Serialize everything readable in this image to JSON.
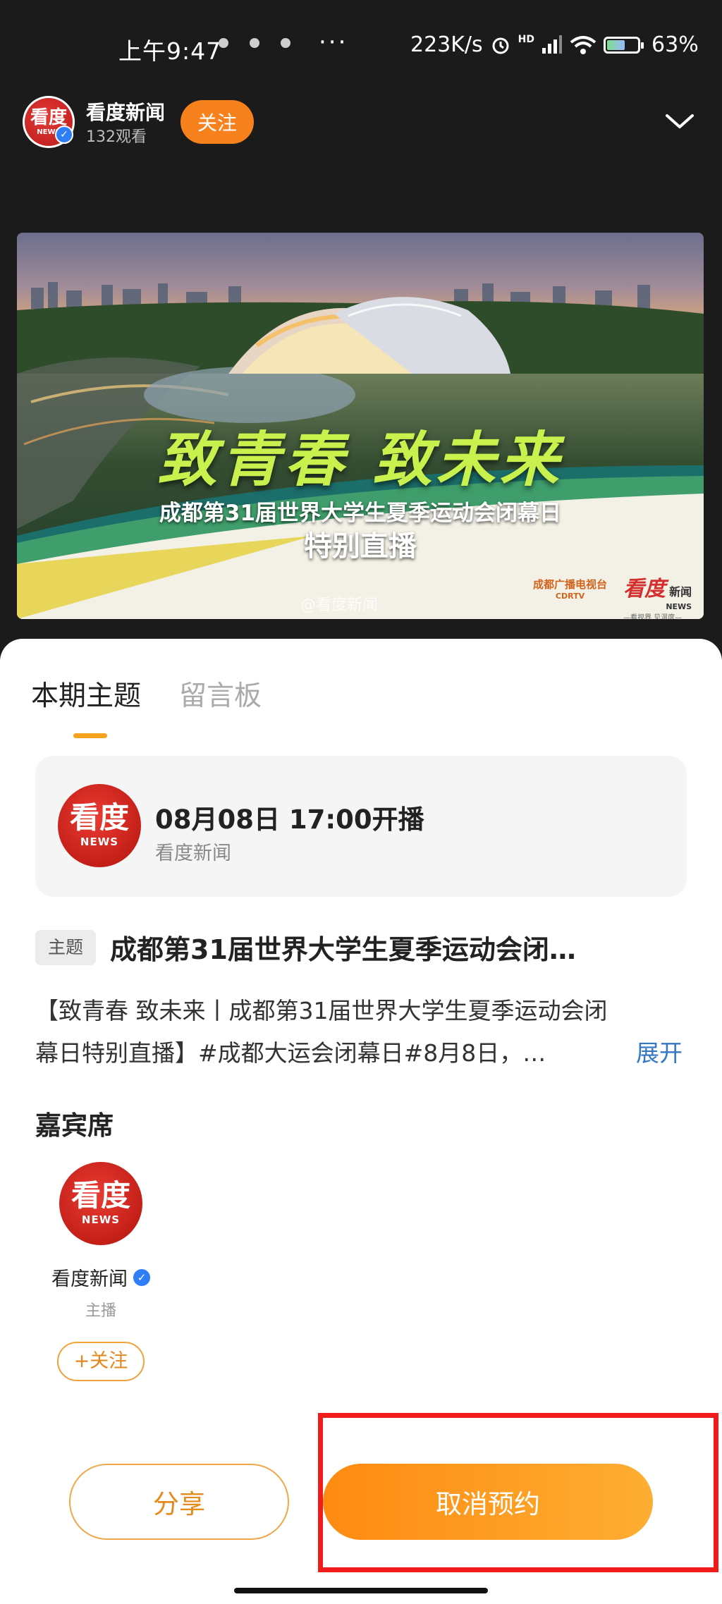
{
  "status_bar": {
    "time": "上午9:47",
    "more": "···",
    "speed": "223K/s",
    "hd": "HD",
    "battery": "63%",
    "battery_level": 0.63
  },
  "header": {
    "channel_name": "看度新闻",
    "viewers": "132观看",
    "follow_label": "关注",
    "logo_text": "看度",
    "logo_sub": "NEWS"
  },
  "banner": {
    "title": "致青春 致未来",
    "subtitle": "成都第31届世界大学生夏季运动会闭幕日",
    "subtitle2": "特别直播",
    "watermark": "@看度新闻",
    "cdrtv_cn": "成都广播电视台",
    "cdrtv_en": "CDRTV",
    "news_a": "看度",
    "news_b": "新闻",
    "news_c": "NEWS",
    "news_d": "—看视界 见温度—"
  },
  "tabs": [
    {
      "label": "本期主题"
    },
    {
      "label": "留言板"
    }
  ],
  "schedule": {
    "logo_text": "看度",
    "logo_sub": "NEWS",
    "time": "08月08日 17:00开播",
    "channel": "看度新闻"
  },
  "topic": {
    "badge": "主题",
    "title": "成都第31届世界大学生夏季运动会闭…",
    "desc_line1": "【致青春 致未来丨成都第31届世界大学生夏季运动会闭",
    "desc_line2": "幕日特别直播】#成都大运会闭幕日#8月8日，…",
    "expand": "展开"
  },
  "guests": {
    "title": "嘉宾席",
    "items": [
      {
        "logo_text": "看度",
        "logo_sub": "NEWS",
        "name": "看度新闻",
        "role": "主播",
        "follow": "+关注"
      }
    ]
  },
  "actions": {
    "share": "分享",
    "cancel": "取消预约"
  },
  "colors": {
    "accent": "#f7821d",
    "highlight": "#f01c1c",
    "link": "#3477c5",
    "verified": "#2d7ef7"
  }
}
